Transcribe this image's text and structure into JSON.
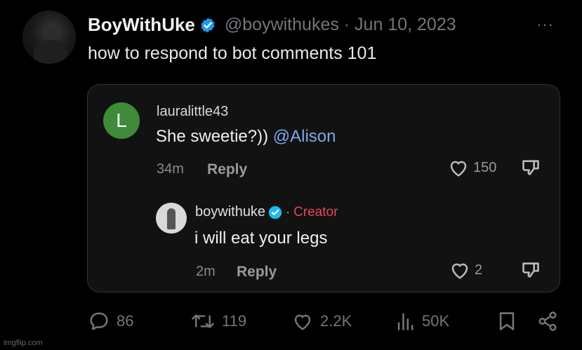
{
  "tweet": {
    "display_name": "BoyWithUke",
    "handle_time": "@boywithukes · Jun 10, 2023",
    "more": "···",
    "text": "how to respond to bot comments 101"
  },
  "comment1": {
    "avatar_letter": "L",
    "username": "lauralittle43",
    "text": "She sweetie?))",
    "mention": "@Alison",
    "time": "34m",
    "reply_label": "Reply",
    "likes": "150"
  },
  "comment2": {
    "username": "boywithuke",
    "dot": "·",
    "creator_label": "Creator",
    "text": "i will eat your legs",
    "time": "2m",
    "reply_label": "Reply",
    "likes": "2"
  },
  "actions": {
    "replies": "86",
    "reposts": "119",
    "likes": "2.2K",
    "views": "50K"
  },
  "watermark": "imgflip.com",
  "colors": {
    "verified": "#1d9bf0",
    "creator": "#e8445a",
    "mention": "#7ea8e8",
    "avatar_l": "#3f8b3a"
  }
}
